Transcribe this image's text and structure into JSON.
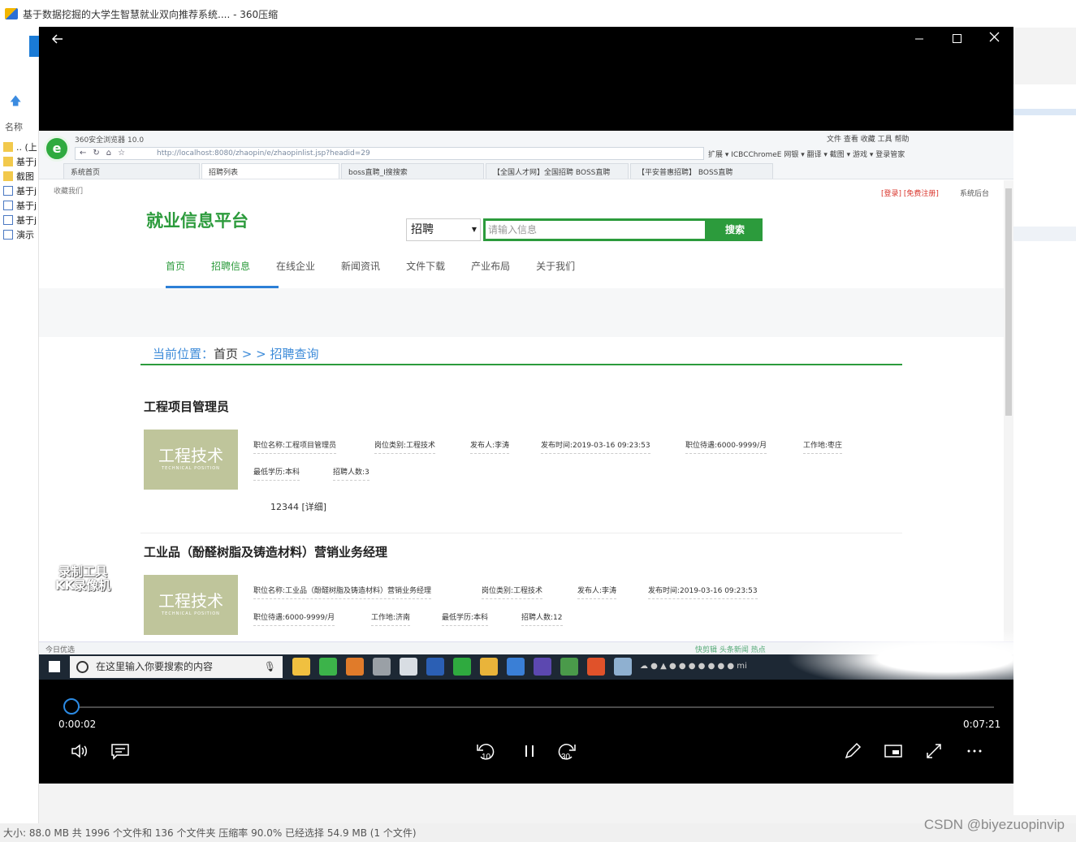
{
  "background_window": {
    "title": "基于数据挖掘的大学生智慧就业双向推荐系统.... - 360压缩",
    "column_name": "名称",
    "rows": [
      ".. (上",
      "基于j",
      "截图",
      "基于j",
      "基于j",
      "基于j",
      "演示"
    ],
    "status_text": "大小: 88.0 MB 共 1996 个文件和 136 个文件夹 压缩率 90.0% 已经选择 54.9 MB (1 个文件)"
  },
  "watermark": "CSDN @biyezuopinvip",
  "browser": {
    "version_label": "360安全浏览器 10.0",
    "menu": "文件  查看  收藏  工具  帮助",
    "address": "http://localhost:8080/zhaopin/e/zhaopinlist.jsp?headid=29",
    "extensions": "扩展 ▾  ICBCChromeE  网银 ▾  翻译 ▾  截图 ▾  游戏 ▾  登录管家",
    "tabs": [
      "系统首页",
      "招聘列表",
      "boss直聘_Ⅰ搜搜索",
      "【全国人才网】全国招聘 BOSS直聘",
      "【平安普惠招聘】 BOSS直聘"
    ]
  },
  "page": {
    "favorite_link": "收藏我们",
    "login_link": "[登录]",
    "register_link": "[免费注册]",
    "admin_link": "系统后台",
    "brand": "就业信息平台",
    "search_type": "招聘",
    "search_placeholder": "请输入信息",
    "search_button": "搜索",
    "nav": [
      "首页",
      "招聘信息",
      "在线企业",
      "新闻资讯",
      "文件下载",
      "产业布局",
      "关于我们"
    ],
    "breadcrumb_prefix": "当前位置：",
    "breadcrumb_home": "首页",
    "breadcrumb_sep": " > > ",
    "breadcrumb_current": "招聘查询",
    "thumb_big": "工程技术",
    "thumb_small": "TECHNICAL POSITION",
    "jobs": [
      {
        "title": "工程项目管理员",
        "fields": [
          "职位名称:工程项目管理员",
          "岗位类别:工程技术",
          "发布人:李涛",
          "发布时间:2019-03-16 09:23:53",
          "职位待遇:6000-9999/月",
          "工作地:枣庄",
          "最低学历:本科",
          "招聘人数:3"
        ],
        "detail": "12344 [详细]"
      },
      {
        "title": "工业品（酚醛树脂及铸造材料）营销业务经理",
        "fields": [
          "职位名称:工业品（酚醛树脂及铸造材料）营销业务经理",
          "岗位类别:工程技术",
          "发布人:李涛",
          "发布时间:2019-03-16 09:23:53",
          "职位待遇:6000-9999/月",
          "工作地:济南",
          "最低学历:本科",
          "招聘人数:12"
        ]
      }
    ],
    "recorder_watermark": [
      "录制工具",
      "KK录像机"
    ],
    "status_left": "今日优选",
    "status_right": "快剪辑   头条新闻   热点"
  },
  "taskbar": {
    "search_placeholder": "在这里输入你要搜索的内容"
  },
  "player": {
    "current_time": "0:00:02",
    "total_time": "0:07:21",
    "progress": 0.005,
    "rewind_label": "10",
    "forward_label": "30"
  }
}
